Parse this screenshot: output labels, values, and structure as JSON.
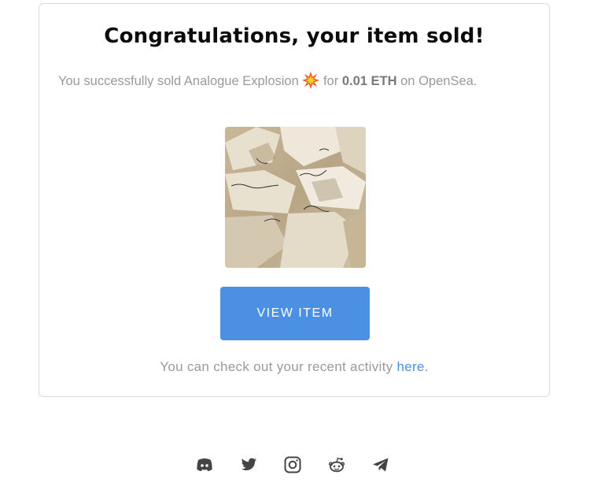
{
  "email": {
    "title": "Congratulations, your item sold!",
    "message_prefix": "You successfully sold",
    "item_name": "Analogue Explosion",
    "emoji": "explosion-emoji",
    "for_label": "for",
    "price": "0.01 ETH",
    "on_label": "on",
    "platform": "OpenSea.",
    "view_button_label": "VIEW ITEM",
    "activity_text": "You can check out your recent activity",
    "activity_link": "here",
    "activity_period": "."
  },
  "footer": {
    "social_icons": [
      "discord-icon",
      "twitter-icon",
      "instagram-icon",
      "reddit-icon",
      "telegram-icon"
    ]
  },
  "colors": {
    "accent": "#4b90e2",
    "text_muted": "#9a9a9a",
    "title": "#0b0b0b",
    "social_icon": "#444444"
  }
}
